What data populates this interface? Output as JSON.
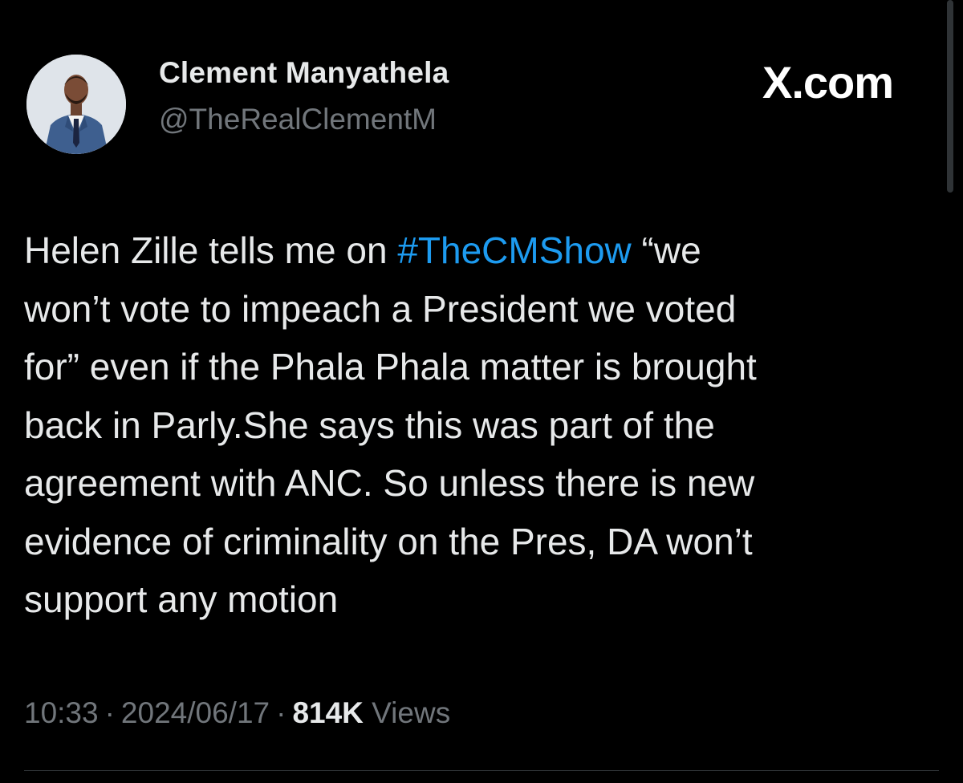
{
  "header": {
    "display_name": "Clement Manyathela",
    "handle": "@TheRealClementM",
    "brand": "X.com"
  },
  "tweet": {
    "lines": [
      {
        "before": "Helen Zille tells me on ",
        "hashtag": "#TheCMShow",
        "after": " “we"
      },
      {
        "text": "won’t vote to impeach a President we voted"
      },
      {
        "text": "for” even if the Phala Phala matter is brought"
      },
      {
        "text": "back in Parly.She says this was part of the"
      },
      {
        "text": "agreement with ANC. So unless there is new"
      },
      {
        "text": "evidence of criminality on the Pres, DA won’t"
      },
      {
        "text": "support any motion"
      }
    ]
  },
  "meta": {
    "time": "10:33",
    "separator": "·",
    "date": "2024/06/17",
    "views_count": "814K",
    "views_label": "Views"
  },
  "colors": {
    "background": "#000000",
    "text": "#e7e9ea",
    "secondary": "#71767b",
    "hashtag": "#1d9bf0"
  },
  "icons": {
    "avatar": "profile-photo"
  }
}
